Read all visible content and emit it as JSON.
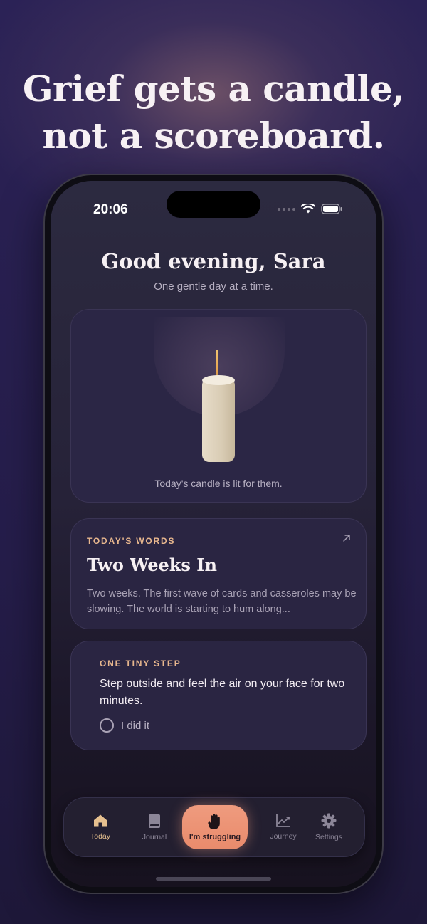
{
  "headline": {
    "line1": "Grief gets a candle,",
    "line2": "not a scoreboard."
  },
  "status": {
    "time": "20:06"
  },
  "greeting": {
    "title": "Good evening, Sara",
    "subtitle": "One gentle day at a time."
  },
  "candle": {
    "caption": "Today's candle is lit for them."
  },
  "todays_words": {
    "eyebrow": "TODAY'S WORDS",
    "title": "Two Weeks In",
    "excerpt": "Two weeks. The first wave of cards and casseroles may be slowing. The world is starting to hum along..."
  },
  "tiny_step": {
    "eyebrow": "ONE TINY STEP",
    "text": "Step outside and feel the air on your face for two minutes.",
    "check_label": "I did it"
  },
  "tabs": [
    {
      "label": "Today",
      "icon": "house-icon"
    },
    {
      "label": "Journal",
      "icon": "book-icon"
    },
    {
      "label": "I'm struggling",
      "icon": "hand-icon"
    },
    {
      "label": "Journey",
      "icon": "chart-icon"
    },
    {
      "label": "Settings",
      "icon": "gear-icon"
    }
  ],
  "colors": {
    "accent": "#e8b78e",
    "struggle_button": "#ef9b7e",
    "background": "#2b2256"
  }
}
